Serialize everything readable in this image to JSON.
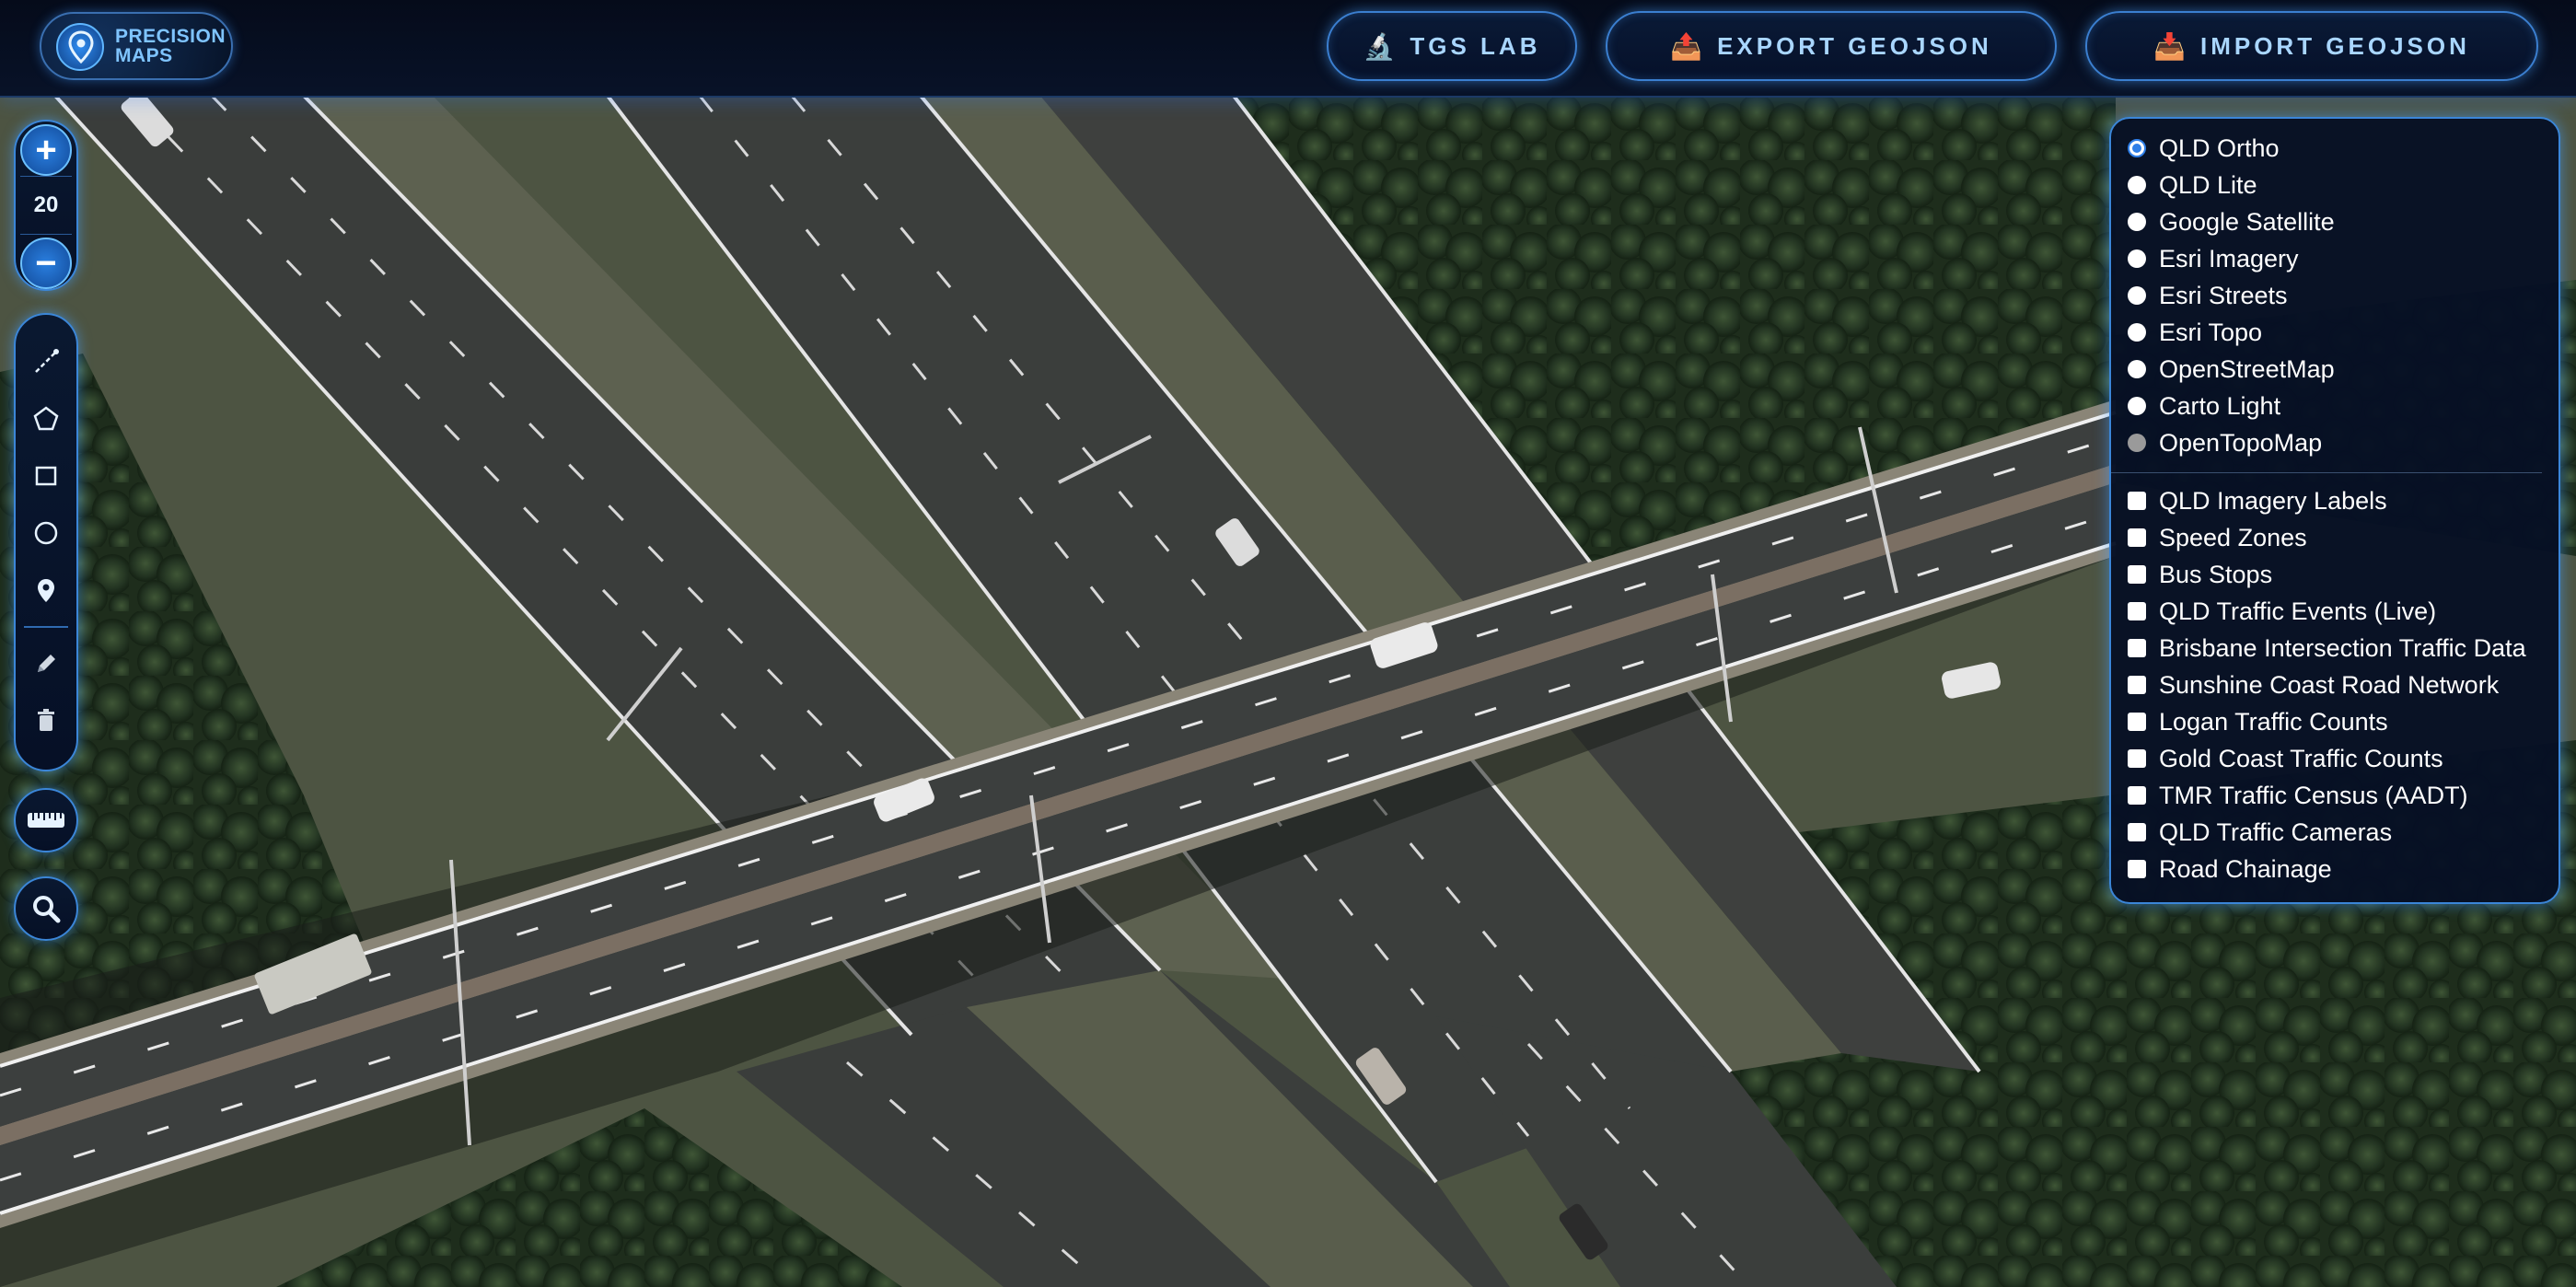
{
  "header": {
    "logo_text_line1": "PRECISION",
    "logo_text_line2": "MAPS",
    "buttons": [
      {
        "icon": "microscope-icon",
        "glyph": "🔬",
        "label": "TGS LAB"
      },
      {
        "icon": "export-tray-icon",
        "glyph": "📤",
        "label": "EXPORT GEOJSON"
      },
      {
        "icon": "import-tray-icon",
        "glyph": "📥",
        "label": "IMPORT GEOJSON"
      }
    ]
  },
  "map_controls": {
    "zoom_level": "20",
    "zoom_in_glyph": "+",
    "zoom_out_glyph": "−",
    "draw_tools": [
      "line-icon",
      "polygon-icon",
      "rectangle-icon",
      "circle-icon",
      "marker-icon",
      "edit-icon",
      "trash-icon"
    ],
    "measure_tool": "ruler-icon",
    "search_tool": "search-icon"
  },
  "layers": {
    "base_maps": [
      {
        "label": "QLD Ortho",
        "state": "selected"
      },
      {
        "label": "QLD Lite",
        "state": "unselected"
      },
      {
        "label": "Google Satellite",
        "state": "unselected"
      },
      {
        "label": "Esri Imagery",
        "state": "unselected"
      },
      {
        "label": "Esri Streets",
        "state": "unselected"
      },
      {
        "label": "Esri Topo",
        "state": "unselected"
      },
      {
        "label": "OpenStreetMap",
        "state": "unselected"
      },
      {
        "label": "Carto Light",
        "state": "unselected"
      },
      {
        "label": "OpenTopoMap",
        "state": "disabled"
      }
    ],
    "overlays": [
      {
        "label": "QLD Imagery Labels",
        "checked": false
      },
      {
        "label": "Speed Zones",
        "checked": false
      },
      {
        "label": "Bus Stops",
        "checked": false
      },
      {
        "label": "QLD Traffic Events (Live)",
        "checked": false
      },
      {
        "label": "Brisbane Intersection Traffic Data",
        "checked": false
      },
      {
        "label": "Sunshine Coast Road Network",
        "checked": false
      },
      {
        "label": "Logan Traffic Counts",
        "checked": false
      },
      {
        "label": "Gold Coast Traffic Counts",
        "checked": false
      },
      {
        "label": "TMR Traffic Census (AADT)",
        "checked": false
      },
      {
        "label": "QLD Traffic Cameras",
        "checked": false
      },
      {
        "label": "Road Chainage",
        "checked": false
      }
    ]
  },
  "theme": {
    "accent": "#3b86d8",
    "panel_bg": "#061024",
    "header_bg": "#050b1a",
    "button_text": "#a9d6ff"
  }
}
